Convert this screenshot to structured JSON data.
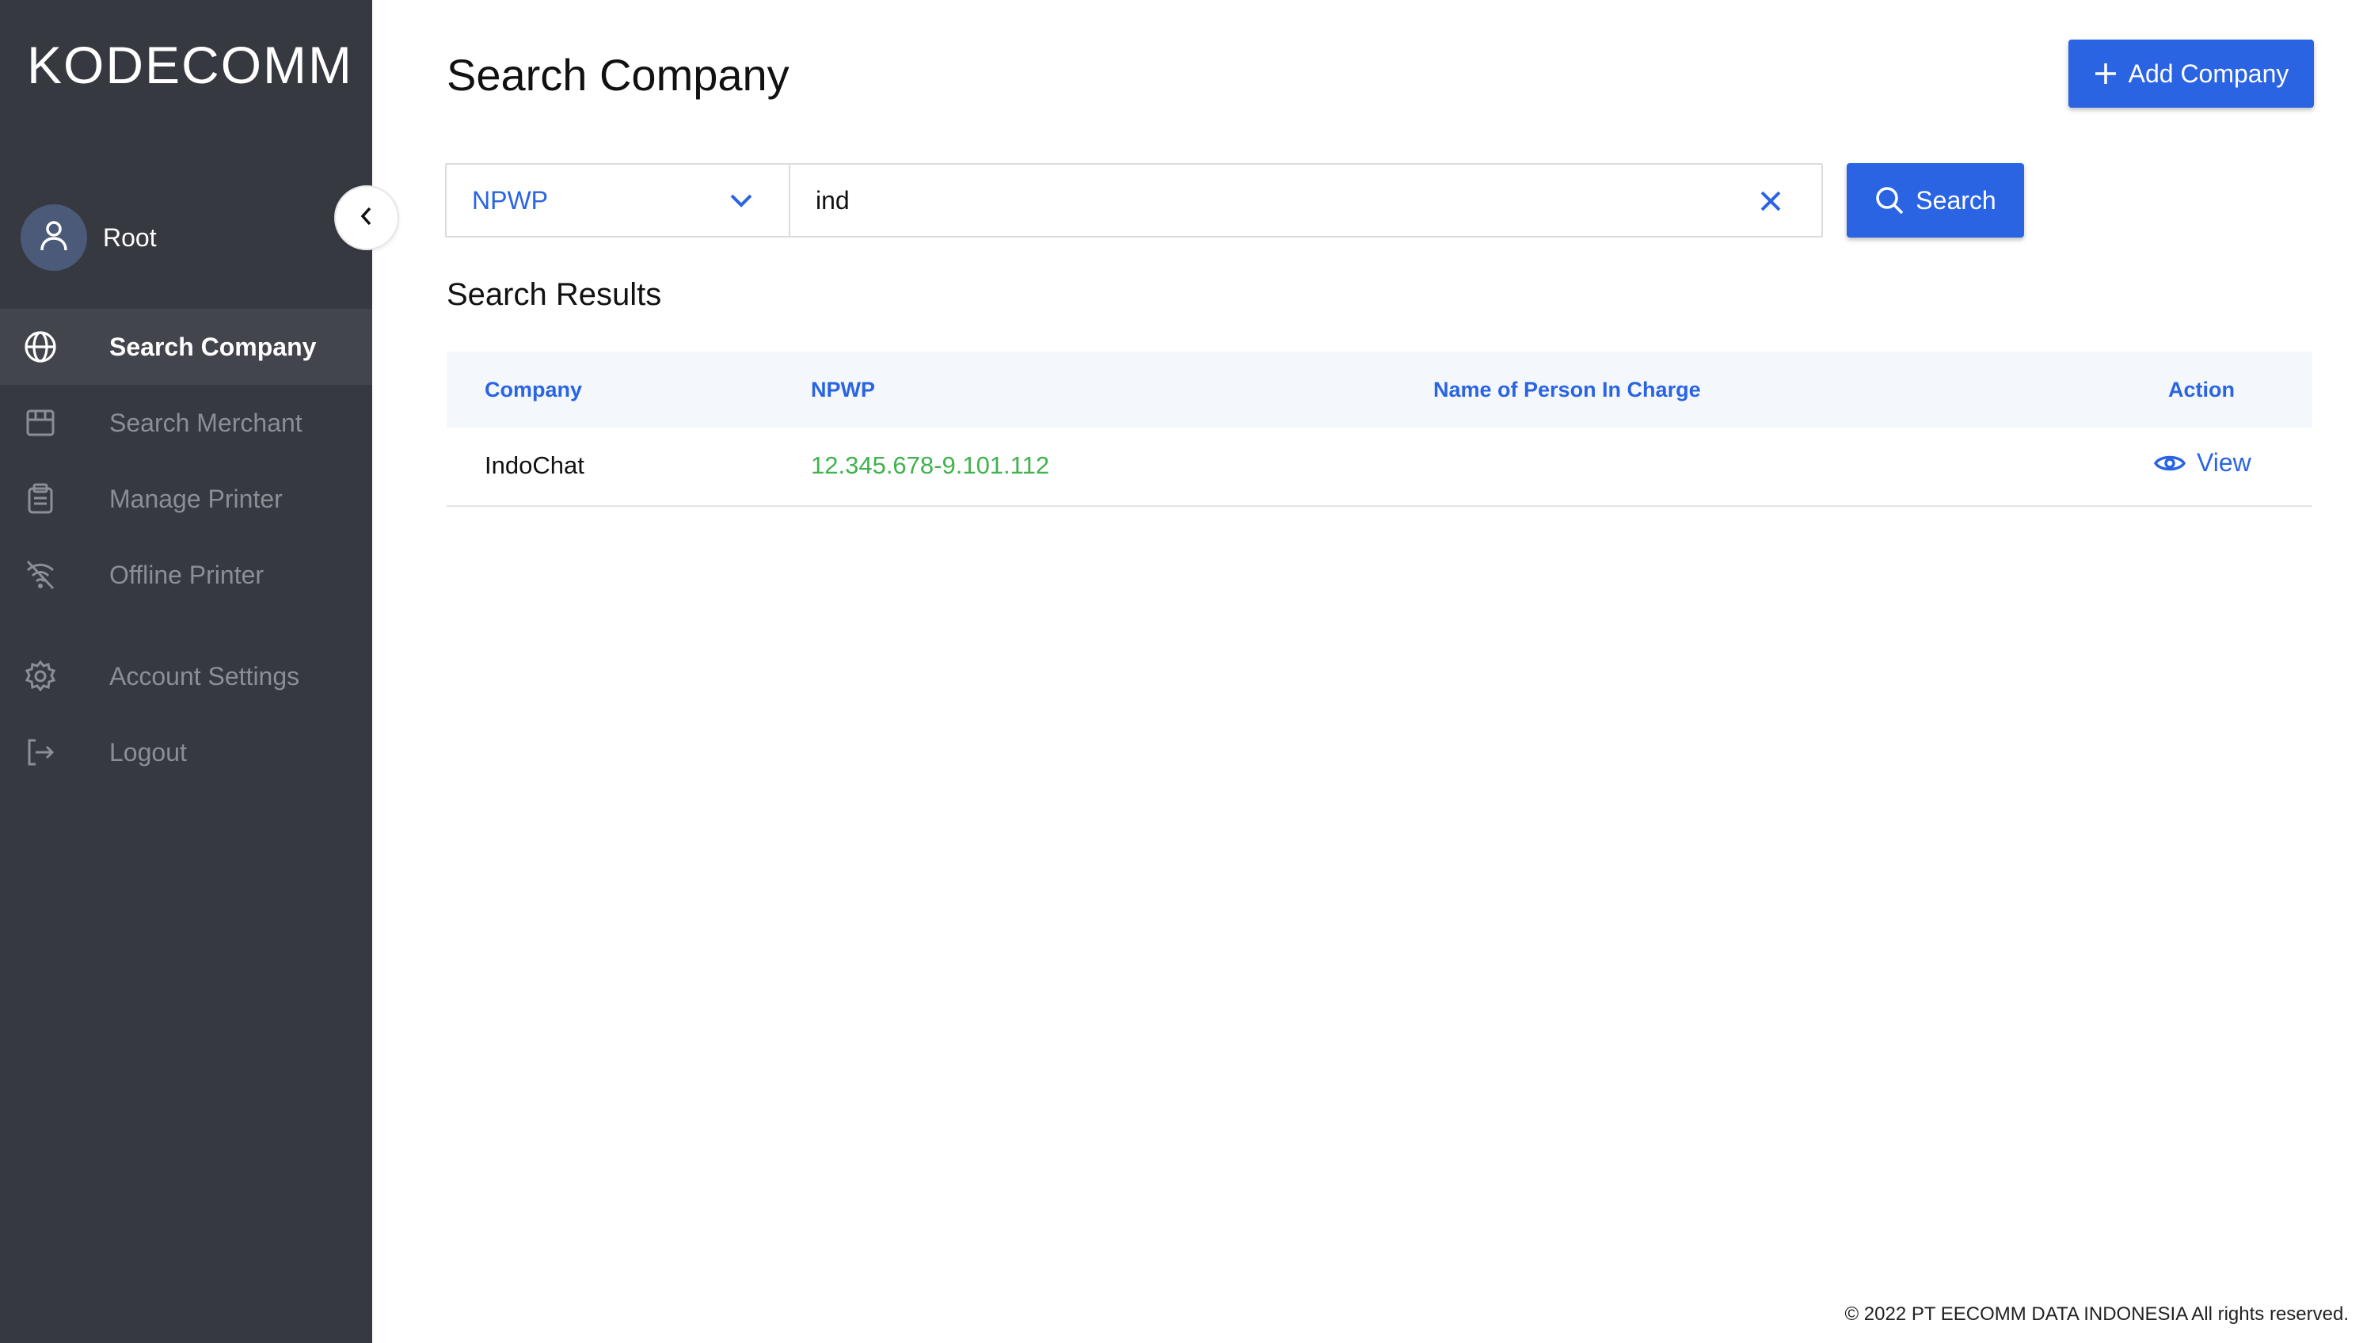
{
  "brand": {
    "logo_text": "KODECOMM"
  },
  "user": {
    "name": "Root"
  },
  "sidebar": {
    "items": [
      {
        "label": "Search Company",
        "icon": "globe-icon",
        "active": true
      },
      {
        "label": "Search Merchant",
        "icon": "store-icon",
        "active": false
      },
      {
        "label": "Manage Printer",
        "icon": "printer-icon",
        "active": false
      },
      {
        "label": "Offline Printer",
        "icon": "wifi-off-icon",
        "active": false
      },
      {
        "label": "Account Settings",
        "icon": "gear-icon",
        "active": false
      },
      {
        "label": "Logout",
        "icon": "logout-icon",
        "active": false
      }
    ]
  },
  "header": {
    "title": "Search Company",
    "add_button_label": "Add Company"
  },
  "search": {
    "filter_value": "NPWP",
    "query": "ind",
    "button_label": "Search"
  },
  "results": {
    "title": "Search Results",
    "columns": [
      "Company",
      "NPWP",
      "Name of Person In Charge",
      "Action"
    ],
    "rows": [
      {
        "company": "IndoChat",
        "npwp": "12.345.678-9.101.112",
        "person_in_charge": "",
        "action_label": "View"
      }
    ]
  },
  "footer": {
    "text": "© 2022 PT EECOMM DATA INDONESIA All rights reserved."
  },
  "colors": {
    "sidebar_bg": "#373941",
    "accent": "#2a64e3",
    "npwp_text": "#3fb24e",
    "table_header_bg": "#f4f8fc"
  }
}
